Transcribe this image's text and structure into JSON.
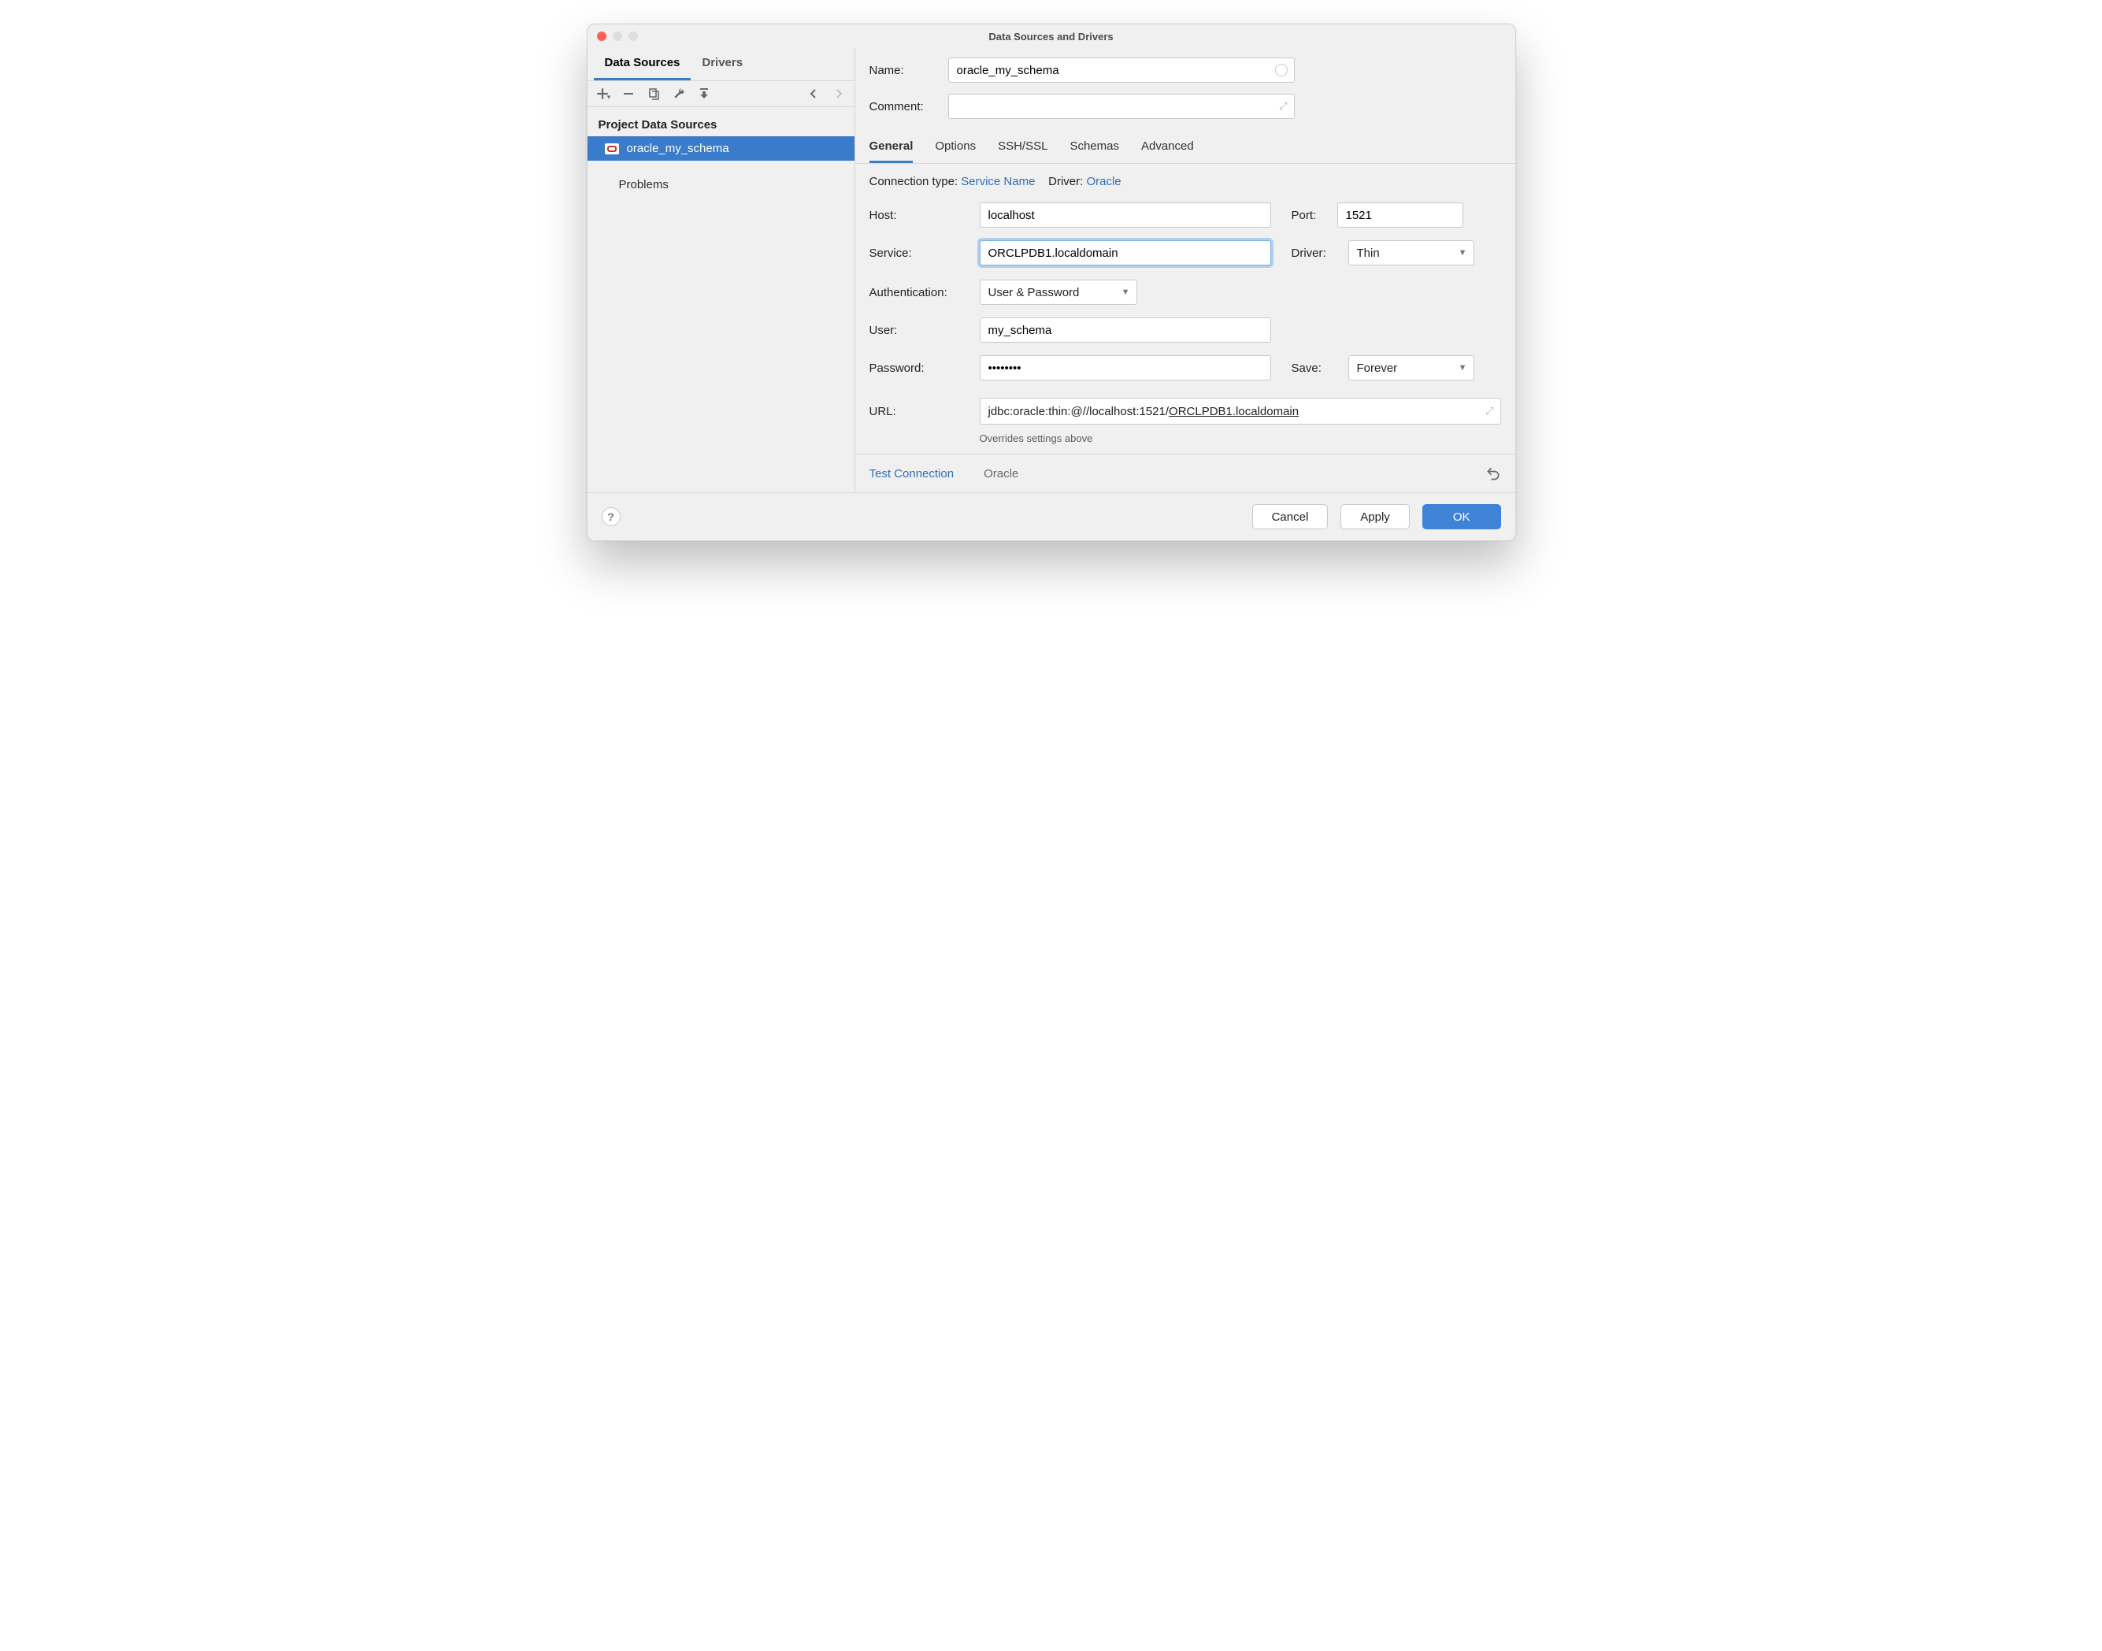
{
  "window": {
    "title": "Data Sources and Drivers"
  },
  "left": {
    "tabs": {
      "data_sources": "Data Sources",
      "drivers": "Drivers"
    },
    "section_label": "Project Data Sources",
    "items": [
      {
        "label": "oracle_my_schema"
      }
    ],
    "problems_label": "Problems"
  },
  "form_top": {
    "name_label": "Name:",
    "name_value": "oracle_my_schema",
    "comment_label": "Comment:",
    "comment_value": ""
  },
  "tabs": {
    "general": "General",
    "options": "Options",
    "sshssl": "SSH/SSL",
    "schemas": "Schemas",
    "advanced": "Advanced"
  },
  "conn_info": {
    "conn_type_label": "Connection type:",
    "conn_type_value": "Service Name",
    "driver_label": "Driver:",
    "driver_value": "Oracle"
  },
  "fields": {
    "host_label": "Host:",
    "host_value": "localhost",
    "port_label": "Port:",
    "port_value": "1521",
    "service_label": "Service:",
    "service_value": "ORCLPDB1.localdomain",
    "driver_label": "Driver:",
    "driver_value": "Thin",
    "auth_label": "Authentication:",
    "auth_value": "User & Password",
    "user_label": "User:",
    "user_value": "my_schema",
    "password_label": "Password:",
    "password_value": "••••••••",
    "save_label": "Save:",
    "save_value": "Forever",
    "url_label": "URL:",
    "url_prefix": "jdbc:oracle:thin:@//localhost:1521/",
    "url_suffix": "ORCLPDB1.localdomain",
    "override_hint": "Overrides settings above"
  },
  "footer": {
    "test_connection": "Test Connection",
    "driver_name": "Oracle"
  },
  "buttons": {
    "help": "?",
    "cancel": "Cancel",
    "apply": "Apply",
    "ok": "OK"
  }
}
